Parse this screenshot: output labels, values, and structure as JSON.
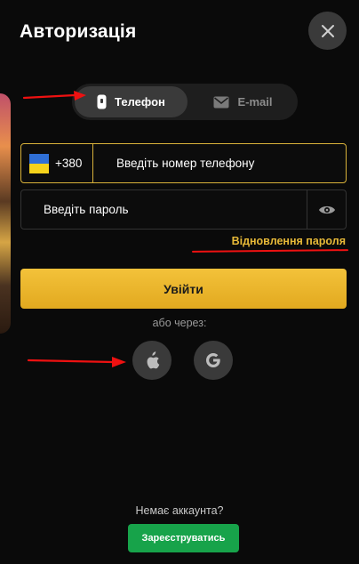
{
  "title": "Авторизація",
  "close_icon": "close-icon",
  "tabs": [
    {
      "label": "Телефон",
      "icon": "phone-icon",
      "active": true
    },
    {
      "label": "E-mail",
      "icon": "mail-icon",
      "active": false
    }
  ],
  "phone": {
    "country_flag": "ukraine-flag-icon",
    "dial_code": "+380",
    "placeholder": "Введіть номер телефону",
    "value": ""
  },
  "password": {
    "placeholder": "Введіть пароль",
    "value": "",
    "toggle_icon": "eye-icon"
  },
  "forgot_password": "Відновлення пароля",
  "login_button": "Увійти",
  "or_via": "або через:",
  "social": [
    {
      "icon": "apple-icon"
    },
    {
      "icon": "google-icon"
    }
  ],
  "no_account": "Немає аккаунта?",
  "register_button": "Зареєструватись",
  "colors": {
    "accent_yellow": "#e7b938",
    "register_green": "#17a34a",
    "annotation_red": "#e11111",
    "flag_blue": "#2f6fd6",
    "flag_yellow": "#f5d21b"
  }
}
